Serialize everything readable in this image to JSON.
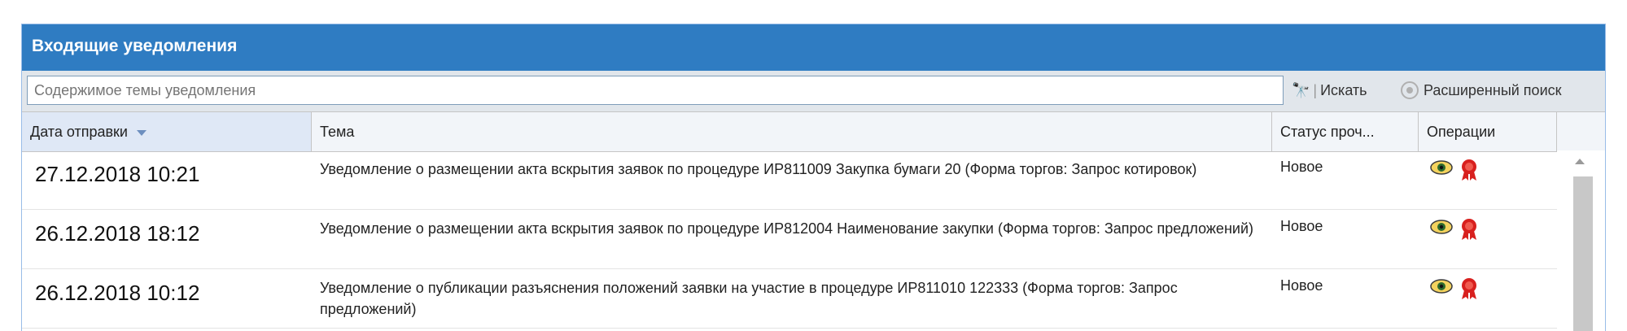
{
  "panel": {
    "title": "Входящие уведомления"
  },
  "toolbar": {
    "search_placeholder": "Содержимое темы уведомления",
    "search_label": "Искать",
    "advanced_label": "Расширенный поиск"
  },
  "grid": {
    "columns": {
      "date": "Дата отправки",
      "subject": "Тема",
      "status": "Статус проч...",
      "operations": "Операции"
    },
    "sort_column": "Дата отправки",
    "sort_direction": "desc",
    "rows": [
      {
        "date": "27.12.2018 10:21",
        "subject": "Уведомление о размещении акта вскрытия заявок по процедуре ИР811009 Закупка бумаги 20 (Форма торгов: Запрос котировок)",
        "status": "Новое"
      },
      {
        "date": "26.12.2018 18:12",
        "subject": "Уведомление о размещении акта вскрытия заявок по процедуре ИР812004 Наименование закупки (Форма торгов: Запрос предложений)",
        "status": "Новое"
      },
      {
        "date": "26.12.2018 10:12",
        "subject": "Уведомление о публикации разъяснения положений заявки на участие в процедуре ИР811010 122333 (Форма торгов: Запрос предложений)",
        "status": "Новое"
      }
    ]
  },
  "icons": {
    "view": "eye-icon",
    "sign": "seal-icon",
    "search": "binoculars-icon",
    "advanced": "gear-icon"
  },
  "colors": {
    "header": "#2f7cc2",
    "seal": "#d8201e"
  }
}
